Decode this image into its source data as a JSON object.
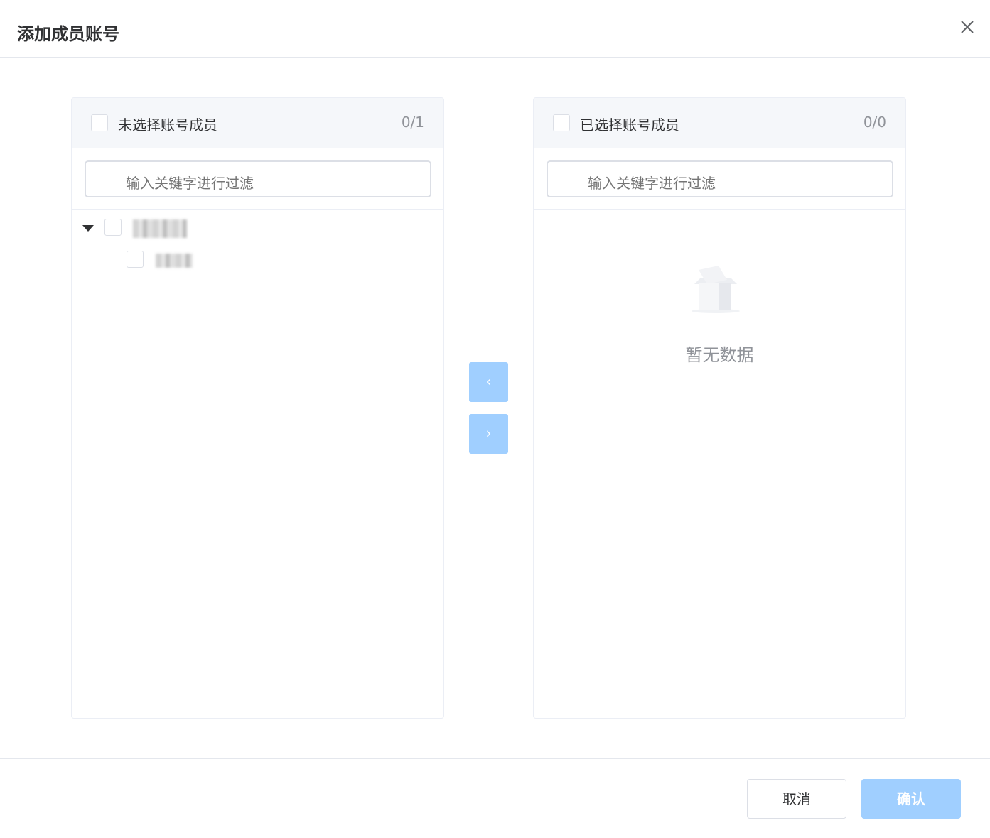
{
  "dialog": {
    "title": "添加成员账号"
  },
  "left_panel": {
    "label": "未选择账号成员",
    "count": "0/1",
    "filter_placeholder": "输入关键字进行过滤"
  },
  "right_panel": {
    "label": "已选择账号成员",
    "count": "0/0",
    "filter_placeholder": "输入关键字进行过滤",
    "empty_text": "暂无数据"
  },
  "transfer": {
    "left_icon": "‹",
    "right_icon": "›"
  },
  "footer": {
    "cancel": "取消",
    "confirm": "确认"
  }
}
